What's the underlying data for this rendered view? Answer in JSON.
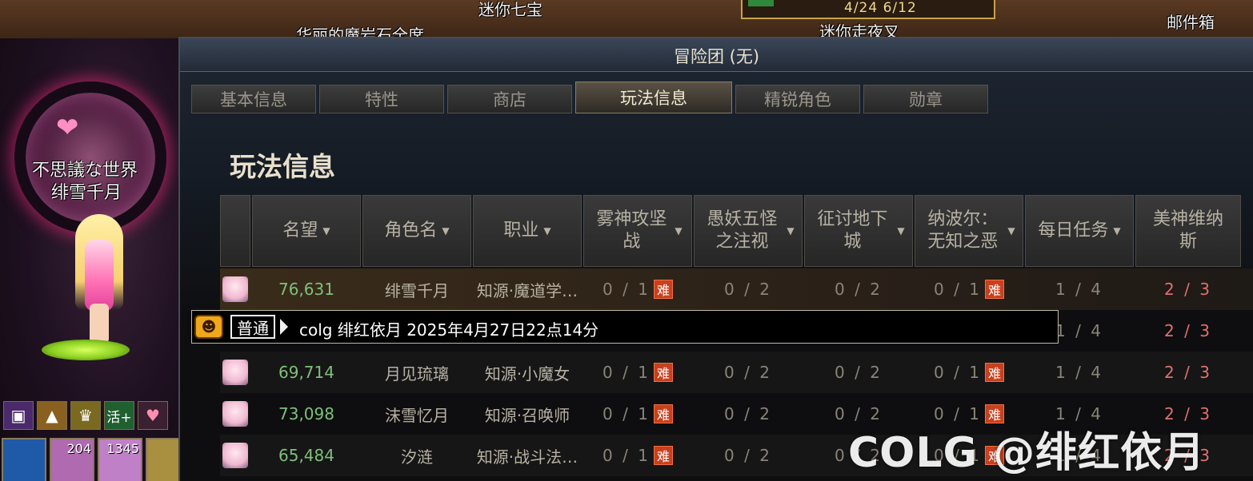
{
  "scene": {
    "top_label_1": "迷你七宝",
    "top_label_2": "华丽的魔岩石全席",
    "top_label_3": "迷你走夜叉",
    "date_box": "4/24 6/12",
    "mailbox": "邮件箱",
    "guild_name": "不思議な世界",
    "player_name": "绯雪千月",
    "buffs": [
      "cube-icon",
      "land-icon",
      "crown-icon",
      "活+",
      "heart-icon"
    ],
    "skill_counts": [
      "",
      "204",
      "1345",
      ""
    ]
  },
  "window": {
    "title": "冒险团 (无)",
    "tabs": [
      "基本信息",
      "特性",
      "商店",
      "玩法信息",
      "精锐角色",
      "勋章"
    ],
    "active_tab": 3,
    "section_title": "玩法信息",
    "columns": [
      {
        "label": "",
        "w": 38
      },
      {
        "label": "名望",
        "arrow": "▼"
      },
      {
        "label": "角色名",
        "arrow": "▼"
      },
      {
        "label": "职业",
        "arrow": "▼"
      },
      {
        "label": "雾神攻坚战",
        "arrow": "▼"
      },
      {
        "label": "愚妖五怪之注视",
        "arrow": "▼"
      },
      {
        "label": "征讨地下城",
        "arrow": "▼"
      },
      {
        "label": "纳波尔：无知之恶",
        "arrow": "▼"
      },
      {
        "label": "每日任务",
        "arrow": "▼"
      },
      {
        "label": "美神维纳斯",
        "arrow": ""
      }
    ],
    "rows": [
      {
        "fame": "76,631",
        "name": "绯雪千月",
        "job": "知源·魔道学…",
        "c1": "0 / 1",
        "c2": "0 / 2",
        "c3": "0 / 2",
        "c4": "0 / 1",
        "c5": "1 / 4",
        "c6": "2 / 3"
      },
      {
        "fame": "",
        "name": "",
        "job": "",
        "c1": "",
        "c2": "",
        "c3": "",
        "c4": "",
        "c5": "1 / 4",
        "c6": "2 / 3"
      },
      {
        "fame": "69,714",
        "name": "月见琉璃",
        "job": "知源·小魔女",
        "c1": "0 / 1",
        "c2": "0 / 2",
        "c3": "0 / 2",
        "c4": "0 / 1",
        "c5": "1 / 4",
        "c6": "2 / 3"
      },
      {
        "fame": "73,098",
        "name": "沫雪忆月",
        "job": "知源·召唤师",
        "c1": "0 / 1",
        "c2": "0 / 2",
        "c3": "0 / 2",
        "c4": "0 / 1",
        "c5": "1 / 4",
        "c6": "2 / 3"
      },
      {
        "fame": "65,484",
        "name": "汐涟",
        "job": "知源·战斗法…",
        "c1": "0 / 1",
        "c2": "0 / 2",
        "c3": "0 / 2",
        "c4": "0 / 1",
        "c5": "1 / 4",
        "c6": "2 / 3"
      }
    ],
    "hard_label": "难"
  },
  "chat": {
    "channel": "普通",
    "message": "colg 绯红依月 2025年4月27日22点14分"
  },
  "watermark": "COLG @绯红依月"
}
